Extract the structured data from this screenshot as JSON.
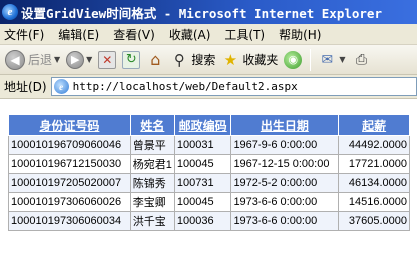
{
  "window": {
    "title": "设置GridView时间格式 - Microsoft Internet Explorer"
  },
  "menubar": {
    "items": [
      "文件(F)",
      "编辑(E)",
      "查看(V)",
      "收藏(A)",
      "工具(T)",
      "帮助(H)"
    ]
  },
  "toolbar": {
    "back_label": "后退",
    "search_label": "搜索",
    "favorites_label": "收藏夹"
  },
  "address": {
    "label": "地址(D)",
    "url": "http://localhost/web/Default2.aspx"
  },
  "grid": {
    "headers": [
      "身份证号码",
      "姓名",
      "邮政编码",
      "出生日期",
      "起薪"
    ],
    "rows": [
      [
        "100010196709060046",
        "曾景平",
        "100031",
        "1967-9-6 0:00:00",
        "44492.0000"
      ],
      [
        "100010196712150030",
        "杨宛君1",
        "100045",
        "1967-12-15 0:00:00",
        "17721.0000"
      ],
      [
        "100010197205020007",
        "陈锦秀",
        "100731",
        "1972-5-2 0:00:00",
        "46134.0000"
      ],
      [
        "100010197306060026",
        "李宝卿",
        "100045",
        "1973-6-6 0:00:00",
        "14516.0000"
      ],
      [
        "100010197306060034",
        "洪千宝",
        "100036",
        "1973-6-6 0:00:00",
        "37605.0000"
      ]
    ]
  },
  "colors": {
    "header_bg": "#507cd1",
    "alt_row_bg": "#eff3fb",
    "titlebar": "#0a246a"
  },
  "icons": {
    "app": "ie-icon",
    "back": "back-arrow-icon",
    "forward": "forward-arrow-icon",
    "stop": "stop-icon",
    "refresh": "refresh-icon",
    "home": "home-icon",
    "search": "search-icon",
    "favorites": "star-icon",
    "media": "media-icon",
    "mail": "mail-icon",
    "print": "print-icon",
    "page": "page-icon"
  }
}
